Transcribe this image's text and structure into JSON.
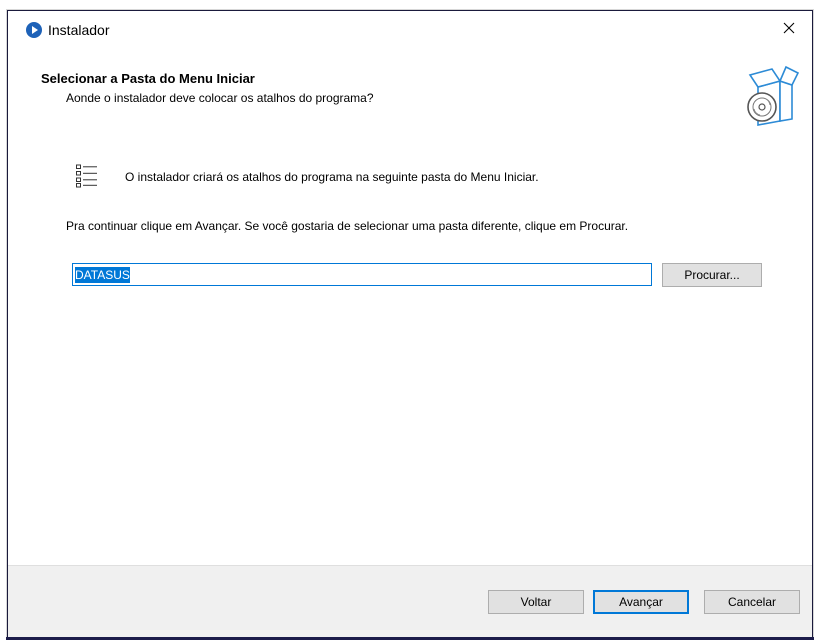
{
  "window": {
    "title": "Instalador",
    "close_label": "✕"
  },
  "header": {
    "title": "Selecionar a Pasta do Menu Iniciar",
    "subtitle": "Aonde o instalador deve colocar os atalhos do programa?"
  },
  "body": {
    "info": "O instalador criará os atalhos do programa na seguinte pasta do Menu Iniciar.",
    "instruction": "Pra continuar clique em Avançar. Se você gostaria de selecionar uma pasta diferente, clique em Procurar.",
    "folder_value": "DATASUS",
    "browse_label": "Procurar..."
  },
  "footer": {
    "back_label": "Voltar",
    "next_label": "Avançar",
    "cancel_label": "Cancelar"
  },
  "icons": {
    "app": "installer-app-icon",
    "close": "close-icon",
    "box": "software-box-icon",
    "list": "shortcut-list-icon"
  },
  "colors": {
    "accent": "#0078d7",
    "button_face": "#e1e1e1",
    "footer_bg": "#f0f0f0",
    "app_icon": "#1e62b8"
  }
}
